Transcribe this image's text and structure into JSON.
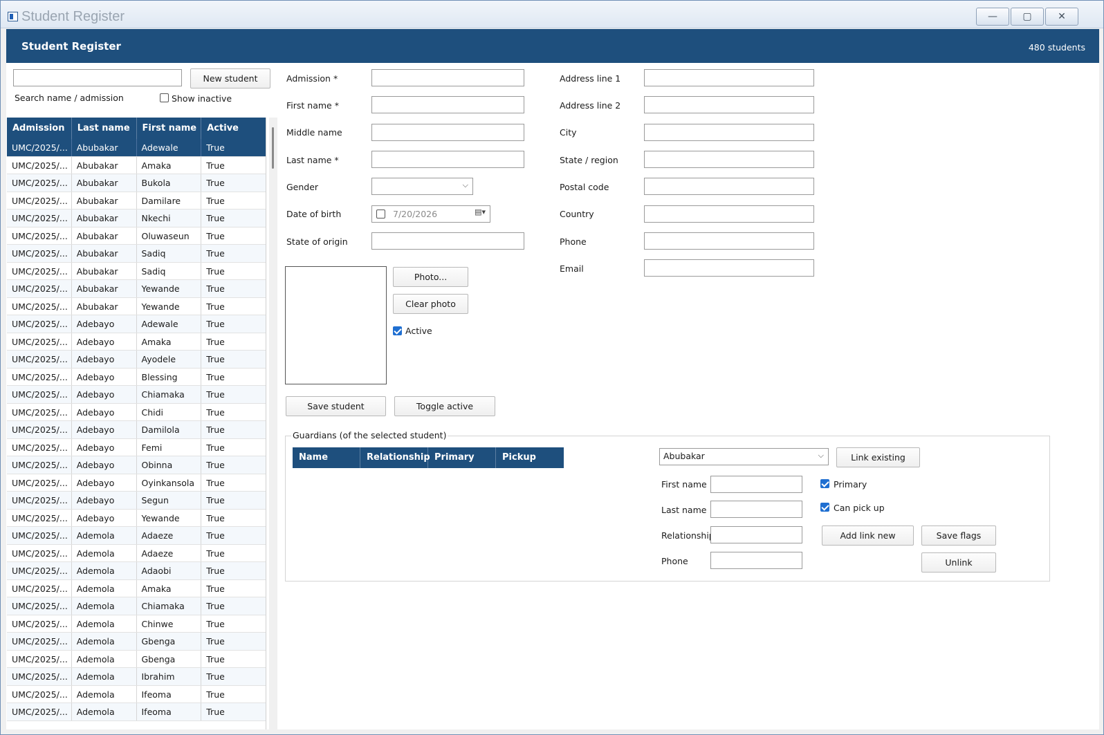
{
  "window": {
    "title": "Student Register",
    "min_icon": "minimize-icon",
    "max_icon": "maximize-icon",
    "close_icon": "close-icon"
  },
  "header": {
    "title": "Student Register",
    "count": "480 students"
  },
  "search": {
    "value": "",
    "label": "Search name / admission",
    "new_student": "New student",
    "show_inactive": "Show inactive"
  },
  "grid": {
    "columns": [
      "Admission",
      "Last name",
      "First name",
      "Active"
    ],
    "rows": [
      [
        "UMC/2025/...",
        "Abubakar",
        "Adewale",
        "True"
      ],
      [
        "UMC/2025/...",
        "Abubakar",
        "Amaka",
        "True"
      ],
      [
        "UMC/2025/...",
        "Abubakar",
        "Bukola",
        "True"
      ],
      [
        "UMC/2025/...",
        "Abubakar",
        "Damilare",
        "True"
      ],
      [
        "UMC/2025/...",
        "Abubakar",
        "Nkechi",
        "True"
      ],
      [
        "UMC/2025/...",
        "Abubakar",
        "Oluwaseun",
        "True"
      ],
      [
        "UMC/2025/...",
        "Abubakar",
        "Sadiq",
        "True"
      ],
      [
        "UMC/2025/...",
        "Abubakar",
        "Sadiq",
        "True"
      ],
      [
        "UMC/2025/...",
        "Abubakar",
        "Yewande",
        "True"
      ],
      [
        "UMC/2025/...",
        "Abubakar",
        "Yewande",
        "True"
      ],
      [
        "UMC/2025/...",
        "Adebayo",
        "Adewale",
        "True"
      ],
      [
        "UMC/2025/...",
        "Adebayo",
        "Amaka",
        "True"
      ],
      [
        "UMC/2025/...",
        "Adebayo",
        "Ayodele",
        "True"
      ],
      [
        "UMC/2025/...",
        "Adebayo",
        "Blessing",
        "True"
      ],
      [
        "UMC/2025/...",
        "Adebayo",
        "Chiamaka",
        "True"
      ],
      [
        "UMC/2025/...",
        "Adebayo",
        "Chidi",
        "True"
      ],
      [
        "UMC/2025/...",
        "Adebayo",
        "Damilola",
        "True"
      ],
      [
        "UMC/2025/...",
        "Adebayo",
        "Femi",
        "True"
      ],
      [
        "UMC/2025/...",
        "Adebayo",
        "Obinna",
        "True"
      ],
      [
        "UMC/2025/...",
        "Adebayo",
        "Oyinkansola",
        "True"
      ],
      [
        "UMC/2025/...",
        "Adebayo",
        "Segun",
        "True"
      ],
      [
        "UMC/2025/...",
        "Adebayo",
        "Yewande",
        "True"
      ],
      [
        "UMC/2025/...",
        "Ademola",
        "Adaeze",
        "True"
      ],
      [
        "UMC/2025/...",
        "Ademola",
        "Adaeze",
        "True"
      ],
      [
        "UMC/2025/...",
        "Ademola",
        "Adaobi",
        "True"
      ],
      [
        "UMC/2025/...",
        "Ademola",
        "Amaka",
        "True"
      ],
      [
        "UMC/2025/...",
        "Ademola",
        "Chiamaka",
        "True"
      ],
      [
        "UMC/2025/...",
        "Ademola",
        "Chinwe",
        "True"
      ],
      [
        "UMC/2025/...",
        "Ademola",
        "Gbenga",
        "True"
      ],
      [
        "UMC/2025/...",
        "Ademola",
        "Gbenga",
        "True"
      ],
      [
        "UMC/2025/...",
        "Ademola",
        "Ibrahim",
        "True"
      ],
      [
        "UMC/2025/...",
        "Ademola",
        "Ifeoma",
        "True"
      ],
      [
        "UMC/2025/...",
        "Ademola",
        "Ifeoma",
        "True"
      ]
    ]
  },
  "form": {
    "admission": "Admission *",
    "first_name": "First name *",
    "middle_name": "Middle name",
    "last_name": "Last name *",
    "gender": "Gender",
    "gender_value": "",
    "dob": "Date of birth",
    "dob_value": "7/20/2026",
    "state_origin": "State of origin",
    "address1": "Address line 1",
    "address2": "Address line 2",
    "city": "City",
    "state_region": "State / region",
    "postal": "Postal code",
    "country": "Country",
    "phone": "Phone",
    "email": "Email",
    "photo_btn": "Photo...",
    "clear_photo_btn": "Clear photo",
    "active": "Active",
    "save_btn": "Save student",
    "toggle_btn": "Toggle active"
  },
  "guardians": {
    "title": "Guardians (of the selected student)",
    "columns": [
      "Name",
      "Relationship",
      "Primary",
      "Pickup"
    ],
    "select_value": "Abubakar",
    "link_existing": "Link existing",
    "first_name": "First name",
    "last_name": "Last name",
    "relationship": "Relationship",
    "phone": "Phone",
    "primary": "Primary",
    "can_pick_up": "Can pick up",
    "add_link_new": "Add  link new",
    "save_flags": "Save flags",
    "unlink": "Unlink"
  },
  "colors": {
    "header": "#1e4f7d",
    "accent": "#1f6fd1"
  }
}
